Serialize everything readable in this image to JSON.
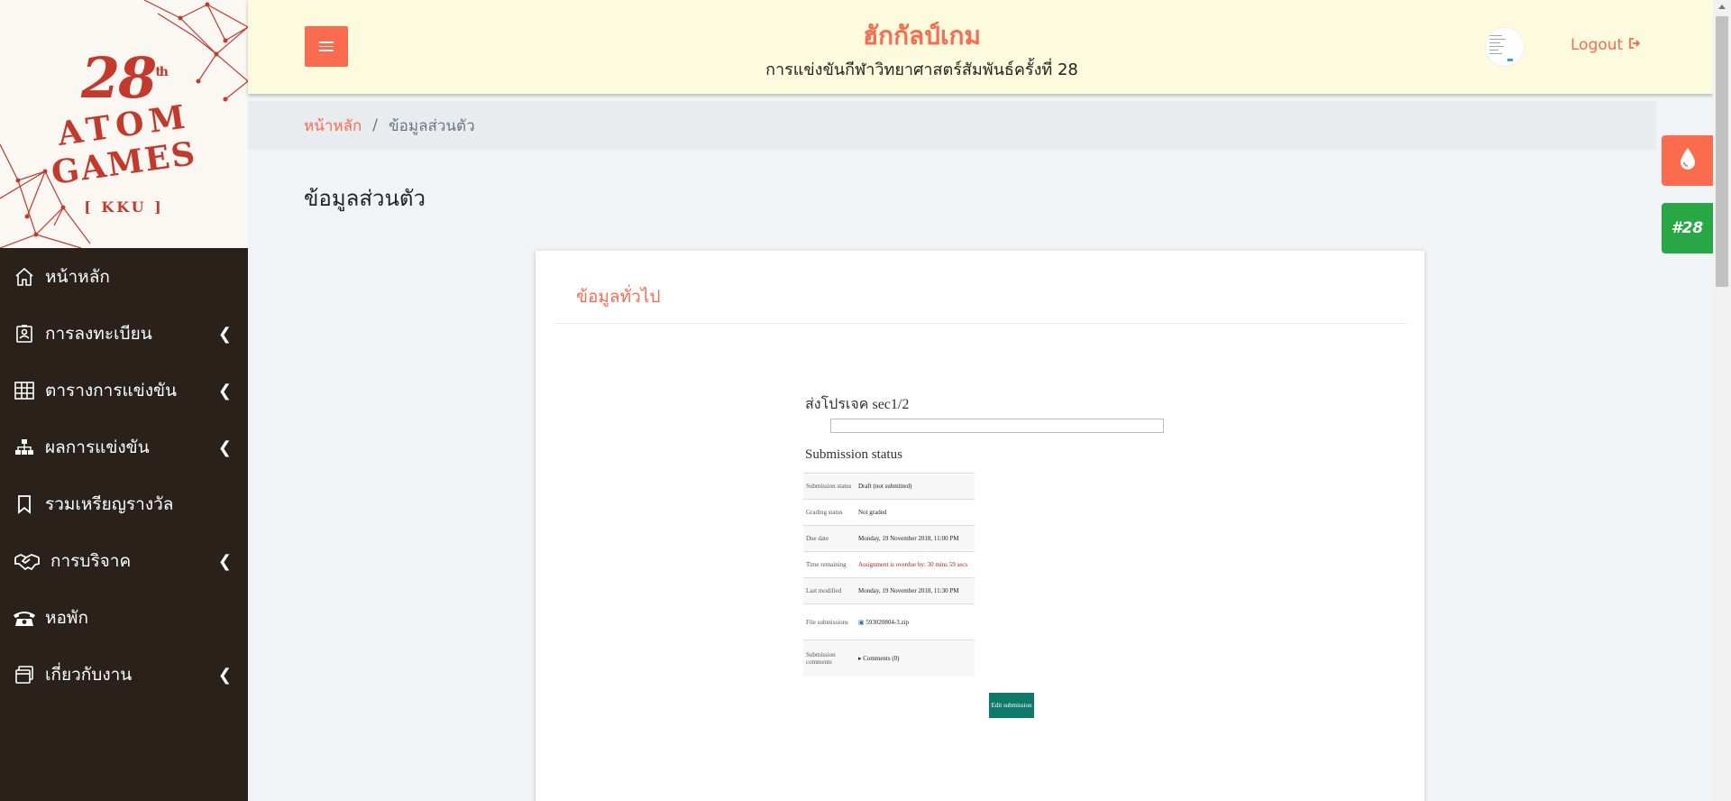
{
  "logo": {
    "number": "28",
    "suffix": "th",
    "line1": "ATOM",
    "line2": "GAMES",
    "line3": "[ KKU ]"
  },
  "sidebar": {
    "items": [
      {
        "label": "หน้าหลัก",
        "icon": "home-icon",
        "has_submenu": false
      },
      {
        "label": "การลงทะเบียน",
        "icon": "registration-icon",
        "has_submenu": true
      },
      {
        "label": "ตารางการแข่งขัน",
        "icon": "table-grid-icon",
        "has_submenu": true
      },
      {
        "label": "ผลการแข่งขัน",
        "icon": "sitemap-icon",
        "has_submenu": true
      },
      {
        "label": "รวมเหรียญรางวัล",
        "icon": "bookmark-icon",
        "has_submenu": false
      },
      {
        "label": "การบริจาค",
        "icon": "handshake-icon",
        "has_submenu": true
      },
      {
        "label": "หอพัก",
        "icon": "phone-icon",
        "has_submenu": false
      },
      {
        "label": "เกี่ยวกับงาน",
        "icon": "window-icon",
        "has_submenu": true
      }
    ]
  },
  "header": {
    "title": "ฮักกัลป์เกม",
    "subtitle": "การแข่งขันกีฬาวิทยาศาสตร์สัมพันธ์ครั้งที่ 28",
    "logout_label": "Logout"
  },
  "breadcrumb": {
    "home": "หน้าหลัก",
    "separator": "/",
    "current": "ข้อมูลส่วนตัว"
  },
  "page": {
    "title": "ข้อมูลส่วนตัว"
  },
  "floating": {
    "badge": "#28"
  },
  "card": {
    "title": "ข้อมูลทั่วไป",
    "embed": {
      "title": "ส่งโปรเจค sec1/2",
      "subtitle": "Submission status",
      "rows": [
        {
          "key": "Submission status",
          "value": "Draft (not submitted)"
        },
        {
          "key": "Grading status",
          "value": "Not graded"
        },
        {
          "key": "Due date",
          "value": "Monday, 19 November 2018, 11:00 PM"
        },
        {
          "key": "Time remaining",
          "value": "Assignment is overdue by: 30 mins 59 secs"
        },
        {
          "key": "Last modified",
          "value": "Monday, 19 November 2018, 11:30 PM"
        },
        {
          "key": "File submissions",
          "value": "593020804-3.zip"
        },
        {
          "key": "Submission comments",
          "value": "Comments (0)"
        }
      ],
      "button": "Edit submission"
    }
  },
  "colors": {
    "accent": "#fb6b4d",
    "sidebar": "#2b211b",
    "header_bg": "#fdfbdd",
    "green": "#28a745"
  }
}
